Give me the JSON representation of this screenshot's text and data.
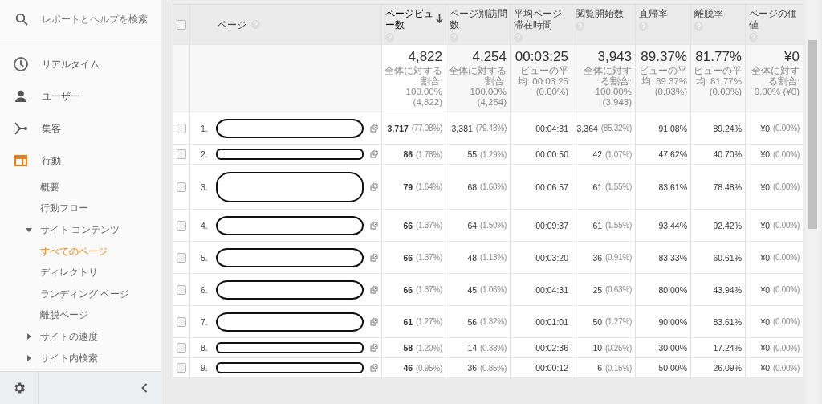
{
  "sidebar": {
    "search": {
      "placeholder": "レポートとヘルプを検索"
    },
    "nav": [
      {
        "label": "リアルタイム",
        "selected": false
      },
      {
        "label": "ユーザー",
        "selected": false
      },
      {
        "label": "集客",
        "selected": false
      },
      {
        "label": "行動",
        "selected": true,
        "children": [
          {
            "label": "概要",
            "selected": false
          },
          {
            "label": "行動フロー",
            "selected": false
          },
          {
            "label": "サイト コンテンツ",
            "expanded": true,
            "children": [
              {
                "label": "すべてのページ",
                "selected": true
              },
              {
                "label": "ディレクトリ",
                "selected": false
              },
              {
                "label": "ランディング ページ",
                "selected": false
              },
              {
                "label": "離脱ページ",
                "selected": false
              }
            ]
          },
          {
            "label": "サイトの速度",
            "expanded": false
          },
          {
            "label": "サイト内検索",
            "expanded": false
          }
        ]
      }
    ]
  },
  "table": {
    "select_all": {
      "checked": false
    },
    "page_header": {
      "label": "ページ"
    },
    "columns": [
      {
        "label": "ページビュー数",
        "sorted": true
      },
      {
        "label": "ページ別訪問数",
        "sorted": false
      },
      {
        "label": "平均ページ滞在時間",
        "sorted": false
      },
      {
        "label": "閲覧開始数",
        "sorted": false
      },
      {
        "label": "直帰率",
        "sorted": false
      },
      {
        "label": "離脱率",
        "sorted": false
      },
      {
        "label": "ページの価値",
        "sorted": false
      }
    ],
    "totals": [
      {
        "value": "4,822",
        "note": "全体に対する割合: 100.00% (4,822)"
      },
      {
        "value": "4,254",
        "note": "全体に対する割合: 100.00% (4,254)"
      },
      {
        "value": "00:03:25",
        "note": "ビューの平均: 00:03:25 (0.00%)"
      },
      {
        "value": "3,943",
        "note": "全体に対する割合: 100.00% (3,943)"
      },
      {
        "value": "89.37%",
        "note": "ビューの平均: 89.37% (0.03%)"
      },
      {
        "value": "81.77%",
        "note": "ビューの平均: 81.77% (0.00%)"
      },
      {
        "value": "¥0",
        "note": "全体に対する割合: 0.00% (¥0)"
      }
    ],
    "rows": [
      {
        "checked": false,
        "index": "1.",
        "kind": "medium",
        "cells": [
          {
            "value": "3,717",
            "pct": "(77.08%)"
          },
          {
            "value": "3,381",
            "pct": "(79.48%)"
          },
          {
            "value": "00:04:31"
          },
          {
            "value": "3,364",
            "pct": "(85.32%)"
          },
          {
            "value": "91.08%"
          },
          {
            "value": "89.24%"
          },
          {
            "value": "¥0",
            "pct": "(0.00%)"
          }
        ]
      },
      {
        "checked": false,
        "index": "2.",
        "kind": "short",
        "cells": [
          {
            "value": "86",
            "pct": "(1.78%)"
          },
          {
            "value": "55",
            "pct": "(1.29%)"
          },
          {
            "value": "00:00:50"
          },
          {
            "value": "42",
            "pct": "(1.07%)"
          },
          {
            "value": "47.62%"
          },
          {
            "value": "40.70%"
          },
          {
            "value": "¥0",
            "pct": "(0.00%)"
          }
        ]
      },
      {
        "checked": false,
        "index": "3.",
        "kind": "tall",
        "cells": [
          {
            "value": "79",
            "pct": "(1.64%)"
          },
          {
            "value": "68",
            "pct": "(1.60%)"
          },
          {
            "value": "00:06:57"
          },
          {
            "value": "61",
            "pct": "(1.55%)"
          },
          {
            "value": "83.61%"
          },
          {
            "value": "78.48%"
          },
          {
            "value": "¥0",
            "pct": "(0.00%)"
          }
        ]
      },
      {
        "checked": false,
        "index": "4.",
        "kind": "medium",
        "cells": [
          {
            "value": "66",
            "pct": "(1.37%)"
          },
          {
            "value": "64",
            "pct": "(1.50%)"
          },
          {
            "value": "00:09:37"
          },
          {
            "value": "61",
            "pct": "(1.55%)"
          },
          {
            "value": "93.44%"
          },
          {
            "value": "92.42%"
          },
          {
            "value": "¥0",
            "pct": "(0.00%)"
          }
        ]
      },
      {
        "checked": false,
        "index": "5.",
        "kind": "medium",
        "cells": [
          {
            "value": "66",
            "pct": "(1.37%)"
          },
          {
            "value": "48",
            "pct": "(1.13%)"
          },
          {
            "value": "00:03:20"
          },
          {
            "value": "36",
            "pct": "(0.91%)"
          },
          {
            "value": "83.33%"
          },
          {
            "value": "60.61%"
          },
          {
            "value": "¥0",
            "pct": "(0.00%)"
          }
        ]
      },
      {
        "checked": false,
        "index": "6.",
        "kind": "medium",
        "cells": [
          {
            "value": "66",
            "pct": "(1.37%)"
          },
          {
            "value": "45",
            "pct": "(1.06%)"
          },
          {
            "value": "00:04:31"
          },
          {
            "value": "25",
            "pct": "(0.63%)"
          },
          {
            "value": "80.00%"
          },
          {
            "value": "43.94%"
          },
          {
            "value": "¥0",
            "pct": "(0.00%)"
          }
        ]
      },
      {
        "checked": false,
        "index": "7.",
        "kind": "medium",
        "cells": [
          {
            "value": "61",
            "pct": "(1.27%)"
          },
          {
            "value": "56",
            "pct": "(1.32%)"
          },
          {
            "value": "00:01:01"
          },
          {
            "value": "50",
            "pct": "(1.27%)"
          },
          {
            "value": "90.00%"
          },
          {
            "value": "83.61%"
          },
          {
            "value": "¥0",
            "pct": "(0.00%)"
          }
        ]
      },
      {
        "checked": false,
        "index": "8.",
        "kind": "short",
        "cells": [
          {
            "value": "58",
            "pct": "(1.20%)"
          },
          {
            "value": "14",
            "pct": "(0.33%)"
          },
          {
            "value": "00:02:36"
          },
          {
            "value": "10",
            "pct": "(0.25%)"
          },
          {
            "value": "30.00%"
          },
          {
            "value": "17.24%"
          },
          {
            "value": "¥0",
            "pct": "(0.00%)"
          }
        ]
      },
      {
        "checked": false,
        "index": "9.",
        "kind": "short",
        "cells": [
          {
            "value": "46",
            "pct": "(0.95%)"
          },
          {
            "value": "36",
            "pct": "(0.85%)"
          },
          {
            "value": "00:00:12"
          },
          {
            "value": "6",
            "pct": "(0.15%)"
          },
          {
            "value": "50.00%"
          },
          {
            "value": "26.09%"
          },
          {
            "value": "¥0",
            "pct": "(0.00%)"
          }
        ]
      }
    ]
  }
}
